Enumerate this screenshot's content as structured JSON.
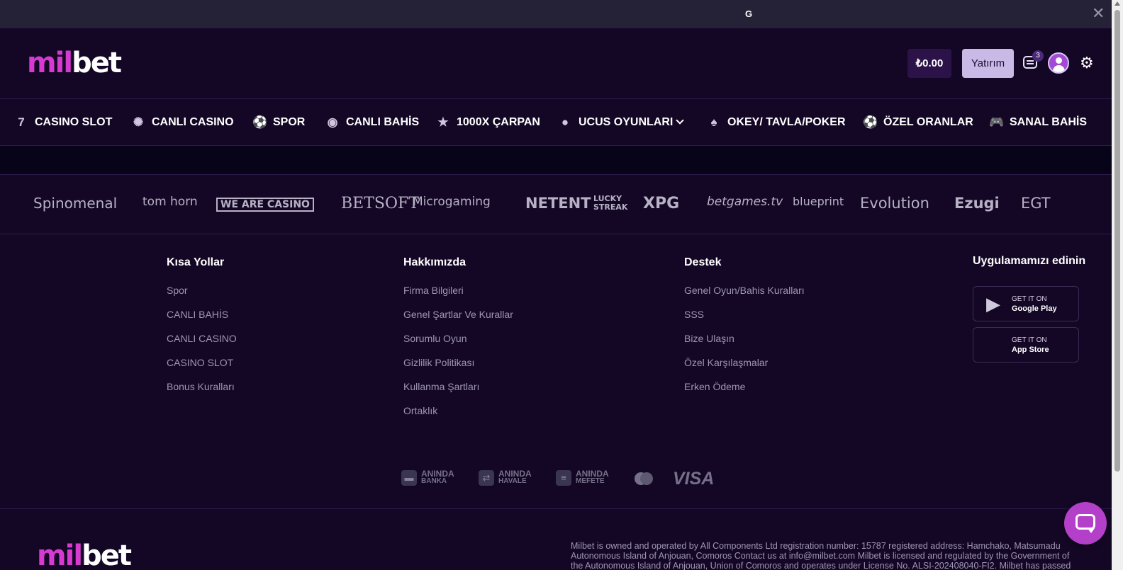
{
  "topbar": {
    "google_glyph": "G",
    "close_label": "✕"
  },
  "header": {
    "logo_m": "mil",
    "logo_b": "bet",
    "balance": "₺0.00",
    "deposit_label": "Yatırım",
    "messages_badge": "3"
  },
  "nav": {
    "items": [
      {
        "label": "CASINO SLOT",
        "icon": "slot-machine-icon"
      },
      {
        "label": "CANLI CASINO",
        "icon": "roulette-icon"
      },
      {
        "label": "SPOR",
        "icon": "soccer-ball-icon"
      },
      {
        "label": "CANLI BAHİS",
        "icon": "live-signal-icon"
      },
      {
        "label": "1000X ÇARPAN",
        "icon": "star-icon"
      },
      {
        "label": "UCUS OYUNLARI",
        "icon": "bomb-icon"
      },
      {
        "label": "OKEY/ TAVLA/POKER",
        "icon": "cards-icon"
      },
      {
        "label": "ÖZEL ORANLAR",
        "icon": "soccer-ball-icon"
      },
      {
        "label": "SANAL BAHİS",
        "icon": "gamepad-icon"
      }
    ]
  },
  "providers": [
    "Spinomenal",
    "tom horn",
    "WE ARE CASINO",
    "BETSOFT",
    "Microgaming",
    "NETENT",
    "LUCKY STREAK",
    "XPG",
    "betgames.tv",
    "blueprint",
    "Evolution",
    "Ezugi",
    "EGT"
  ],
  "footer": {
    "columns": [
      {
        "title": "Kısa Yollar",
        "links": [
          "Spor",
          "CANLI BAHİS",
          "CANLI CASINO",
          "CASINO SLOT",
          "Bonus Kuralları"
        ]
      },
      {
        "title": "Hakkımızda",
        "links": [
          "Firma Bilgileri",
          "Genel Şartlar Ve Kurallar",
          "Sorumlu Oyun",
          "Gizlilik Politikası",
          "Kullanma Şartları",
          "Ortaklık"
        ]
      },
      {
        "title": "Destek",
        "links": [
          "Genel Oyun/Bahis Kuralları",
          "SSS",
          "Bize Ulaşın",
          "Özel Karşılaşmalar",
          "Erken Ödeme"
        ]
      }
    ],
    "app_title": "Uygulamamızı edinin",
    "google_play": {
      "line1": "GET IT ON",
      "line2": "Google Play"
    },
    "app_store": {
      "line1": "GET IT ON",
      "line2": "App Store"
    },
    "payments": [
      {
        "a": "ANINDA",
        "b": "BANKA"
      },
      {
        "a": "ANINDA",
        "b": "HAVALE"
      },
      {
        "a": "ANINDA",
        "b": "MEFETE"
      }
    ],
    "visa": "VISA",
    "legal": "Milbet is owned and operated by All Components Ltd registration number: 15787 registered address: Hamchako, Matsumadu Autonomous Island of Anjouan, Comoros Contact us at info@milbet.com Milbet is licensed and regulated by the Government of the Autonomous Island of Anjouan, Union of Comoros and operates under License No. ALSI-202408040-FI2. Milbet has passed all regulatory"
  }
}
